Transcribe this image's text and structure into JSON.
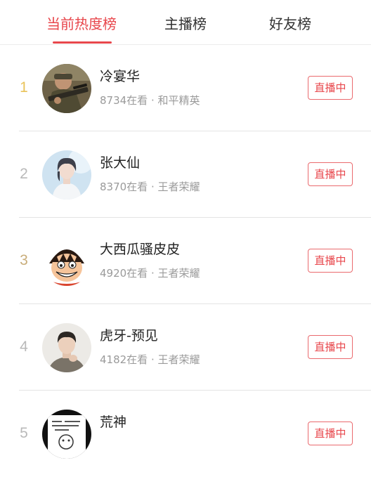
{
  "tabs": [
    {
      "label": "当前热度榜",
      "active": true
    },
    {
      "label": "主播榜",
      "active": false
    },
    {
      "label": "好友榜",
      "active": false
    }
  ],
  "colors": {
    "accent": "#e8474c",
    "rank_top": "#e9c35a",
    "rank_other": "#b9b9b9",
    "text_primary": "#222222",
    "text_secondary": "#9a9a9a",
    "divider": "#e4e4e4"
  },
  "list": {
    "rows": [
      {
        "rank": "1",
        "name": "冷宴华",
        "meta": "8734在看 · 和平精英",
        "button": "直播中",
        "avatar_icon": "soldier-avatar-icon"
      },
      {
        "rank": "2",
        "name": "张大仙",
        "meta": "8370在看 · 王者荣耀",
        "button": "直播中",
        "avatar_icon": "person-avatar-icon"
      },
      {
        "rank": "3",
        "name": "大西瓜骚皮皮",
        "meta": "4920在看 · 王者荣耀",
        "button": "直播中",
        "avatar_icon": "cartoon-pirate-avatar-icon"
      },
      {
        "rank": "4",
        "name": "虎牙-预见",
        "meta": "4182在看 · 王者荣耀",
        "button": "直播中",
        "avatar_icon": "person-avatar-icon"
      },
      {
        "rank": "5",
        "name": "荒神",
        "meta": "",
        "button": "直播中",
        "avatar_icon": "meme-avatar-icon"
      }
    ]
  }
}
